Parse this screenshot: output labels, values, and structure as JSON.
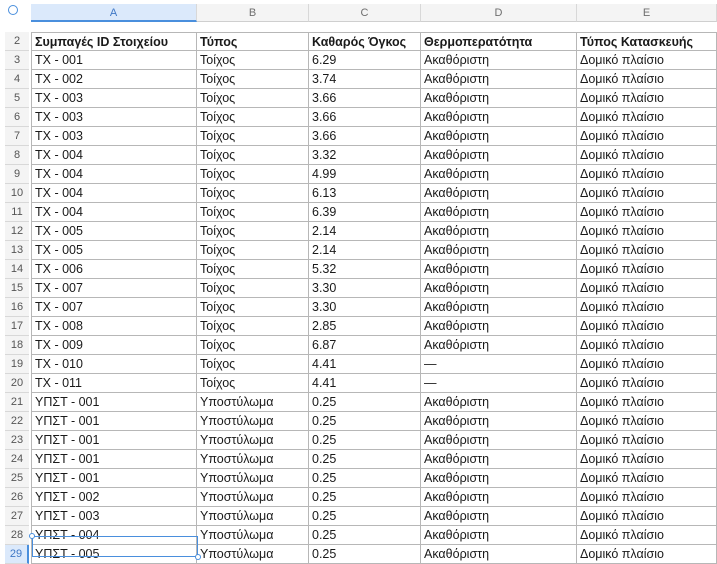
{
  "columns": [
    "A",
    "B",
    "C",
    "D",
    "E"
  ],
  "selected_column": "A",
  "selected_row": "29",
  "header_row": {
    "num": "2",
    "cells": [
      "Συμπαγές ID Στοιχείου",
      "Τύπος",
      "Καθαρός Όγκος",
      "Θερμοπερατότητα",
      "Τύπος Κατασκευής"
    ]
  },
  "rows": [
    {
      "num": "3",
      "cells": [
        "ΤΧ - 001",
        "Τοίχος",
        "6.29",
        "Ακαθόριστη",
        "Δομικό πλαίσιο"
      ]
    },
    {
      "num": "4",
      "cells": [
        "ΤΧ - 002",
        "Τοίχος",
        "3.74",
        "Ακαθόριστη",
        "Δομικό πλαίσιο"
      ]
    },
    {
      "num": "5",
      "cells": [
        "ΤΧ - 003",
        "Τοίχος",
        "3.66",
        "Ακαθόριστη",
        "Δομικό πλαίσιο"
      ]
    },
    {
      "num": "6",
      "cells": [
        "ΤΧ - 003",
        "Τοίχος",
        "3.66",
        "Ακαθόριστη",
        "Δομικό πλαίσιο"
      ]
    },
    {
      "num": "7",
      "cells": [
        "ΤΧ - 003",
        "Τοίχος",
        "3.66",
        "Ακαθόριστη",
        "Δομικό πλαίσιο"
      ]
    },
    {
      "num": "8",
      "cells": [
        "ΤΧ - 004",
        "Τοίχος",
        "3.32",
        "Ακαθόριστη",
        "Δομικό πλαίσιο"
      ]
    },
    {
      "num": "9",
      "cells": [
        "ΤΧ - 004",
        "Τοίχος",
        "4.99",
        "Ακαθόριστη",
        "Δομικό πλαίσιο"
      ]
    },
    {
      "num": "10",
      "cells": [
        "ΤΧ - 004",
        "Τοίχος",
        "6.13",
        "Ακαθόριστη",
        "Δομικό πλαίσιο"
      ]
    },
    {
      "num": "11",
      "cells": [
        "ΤΧ - 004",
        "Τοίχος",
        "6.39",
        "Ακαθόριστη",
        "Δομικό πλαίσιο"
      ]
    },
    {
      "num": "12",
      "cells": [
        "ΤΧ - 005",
        "Τοίχος",
        "2.14",
        "Ακαθόριστη",
        "Δομικό πλαίσιο"
      ]
    },
    {
      "num": "13",
      "cells": [
        "ΤΧ - 005",
        "Τοίχος",
        "2.14",
        "Ακαθόριστη",
        "Δομικό πλαίσιο"
      ]
    },
    {
      "num": "14",
      "cells": [
        "ΤΧ - 006",
        "Τοίχος",
        "5.32",
        "Ακαθόριστη",
        "Δομικό πλαίσιο"
      ]
    },
    {
      "num": "15",
      "cells": [
        "ΤΧ - 007",
        "Τοίχος",
        "3.30",
        "Ακαθόριστη",
        "Δομικό πλαίσιο"
      ]
    },
    {
      "num": "16",
      "cells": [
        "ΤΧ - 007",
        "Τοίχος",
        "3.30",
        "Ακαθόριστη",
        "Δομικό πλαίσιο"
      ]
    },
    {
      "num": "17",
      "cells": [
        "ΤΧ - 008",
        "Τοίχος",
        "2.85",
        "Ακαθόριστη",
        "Δομικό πλαίσιο"
      ]
    },
    {
      "num": "18",
      "cells": [
        "ΤΧ - 009",
        "Τοίχος",
        "6.87",
        "Ακαθόριστη",
        "Δομικό πλαίσιο"
      ]
    },
    {
      "num": "19",
      "cells": [
        "ΤΧ - 010",
        "Τοίχος",
        "4.41",
        "—",
        "Δομικό πλαίσιο"
      ]
    },
    {
      "num": "20",
      "cells": [
        "ΤΧ - 011",
        "Τοίχος",
        "4.41",
        "—",
        "Δομικό πλαίσιο"
      ]
    },
    {
      "num": "21",
      "cells": [
        "ΥΠΣΤ - 001",
        "Υποστύλωμα",
        "0.25",
        "Ακαθόριστη",
        "Δομικό πλαίσιο"
      ]
    },
    {
      "num": "22",
      "cells": [
        "ΥΠΣΤ - 001",
        "Υποστύλωμα",
        "0.25",
        "Ακαθόριστη",
        "Δομικό πλαίσιο"
      ]
    },
    {
      "num": "23",
      "cells": [
        "ΥΠΣΤ - 001",
        "Υποστύλωμα",
        "0.25",
        "Ακαθόριστη",
        "Δομικό πλαίσιο"
      ]
    },
    {
      "num": "24",
      "cells": [
        "ΥΠΣΤ - 001",
        "Υποστύλωμα",
        "0.25",
        "Ακαθόριστη",
        "Δομικό πλαίσιο"
      ]
    },
    {
      "num": "25",
      "cells": [
        "ΥΠΣΤ - 001",
        "Υποστύλωμα",
        "0.25",
        "Ακαθόριστη",
        "Δομικό πλαίσιο"
      ]
    },
    {
      "num": "26",
      "cells": [
        "ΥΠΣΤ - 002",
        "Υποστύλωμα",
        "0.25",
        "Ακαθόριστη",
        "Δομικό πλαίσιο"
      ]
    },
    {
      "num": "27",
      "cells": [
        "ΥΠΣΤ - 003",
        "Υποστύλωμα",
        "0.25",
        "Ακαθόριστη",
        "Δομικό πλαίσιο"
      ]
    },
    {
      "num": "28",
      "cells": [
        "ΥΠΣΤ - 004",
        "Υποστύλωμα",
        "0.25",
        "Ακαθόριστη",
        "Δομικό πλαίσιο"
      ]
    },
    {
      "num": "29",
      "cells": [
        "ΥΠΣΤ - 005",
        "Υποστύλωμα",
        "0.25",
        "Ακαθόριστη",
        "Δομικό πλαίσιο"
      ]
    }
  ]
}
